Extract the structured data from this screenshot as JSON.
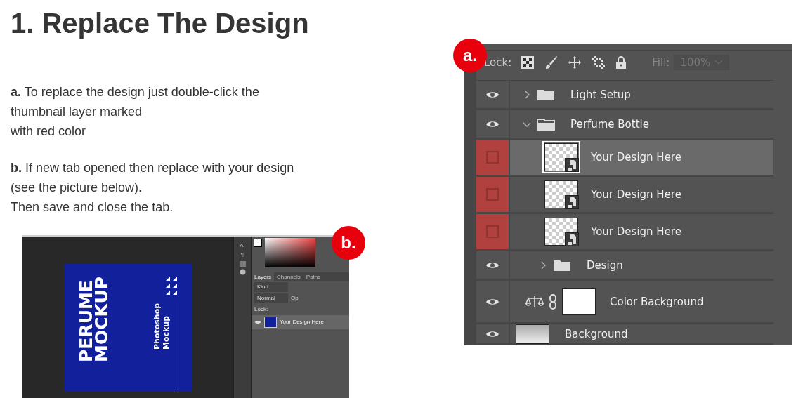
{
  "heading": "1. Replace The Design",
  "steps": [
    {
      "text": "**a.** To replace the design just double-click the\nthumbnail layer marked\nwith red color"
    },
    {
      "text": "**b.** If new tab opened then replace with your design\n(see the picture below).\nThen save and close the tab."
    }
  ],
  "photoshop_window": {
    "badge": "b.",
    "artwork": {
      "title_lines": [
        "PERUME",
        "MOCKUP"
      ],
      "subtitle_lines": [
        "Photoshop",
        "Mockup"
      ]
    },
    "tools": [
      "A|",
      "¶"
    ],
    "tabs": [
      {
        "label": "Layers",
        "selected": true
      },
      {
        "label": "Channels",
        "selected": false
      },
      {
        "label": "Paths",
        "selected": false
      }
    ],
    "filter": "Kind",
    "blend_mode": "Normal",
    "opacity_label": "Op",
    "lock_label": "Lock:",
    "layer": {
      "name": "Your Design Here",
      "visible": true
    }
  },
  "layers_panel": {
    "badge": "a.",
    "lock_label": "Lock:",
    "fill_label": "Fill:",
    "fill_value": "100%",
    "layers": [
      {
        "kind": "group",
        "name": "Light Setup",
        "visible": true,
        "expanded": false,
        "selected": false
      },
      {
        "kind": "group",
        "name": "Perfume Bottle",
        "visible": true,
        "expanded": true,
        "selected": false,
        "children": [
          {
            "kind": "smart",
            "name": "Your Design Here",
            "visible": false,
            "selected": true,
            "color": "#b0413e"
          },
          {
            "kind": "smart",
            "name": "Your Design Here",
            "visible": false,
            "selected": false,
            "color": "#b0413e"
          },
          {
            "kind": "smart",
            "name": "Your Design Here",
            "visible": false,
            "selected": false,
            "color": "#b0413e"
          },
          {
            "kind": "group",
            "name": "Design",
            "visible": true,
            "expanded": false,
            "selected": false
          }
        ]
      },
      {
        "kind": "adjustment",
        "name": "Color Background",
        "visible": true,
        "selected": false
      },
      {
        "kind": "layer",
        "name": "Background",
        "visible": true,
        "selected": false
      }
    ]
  }
}
